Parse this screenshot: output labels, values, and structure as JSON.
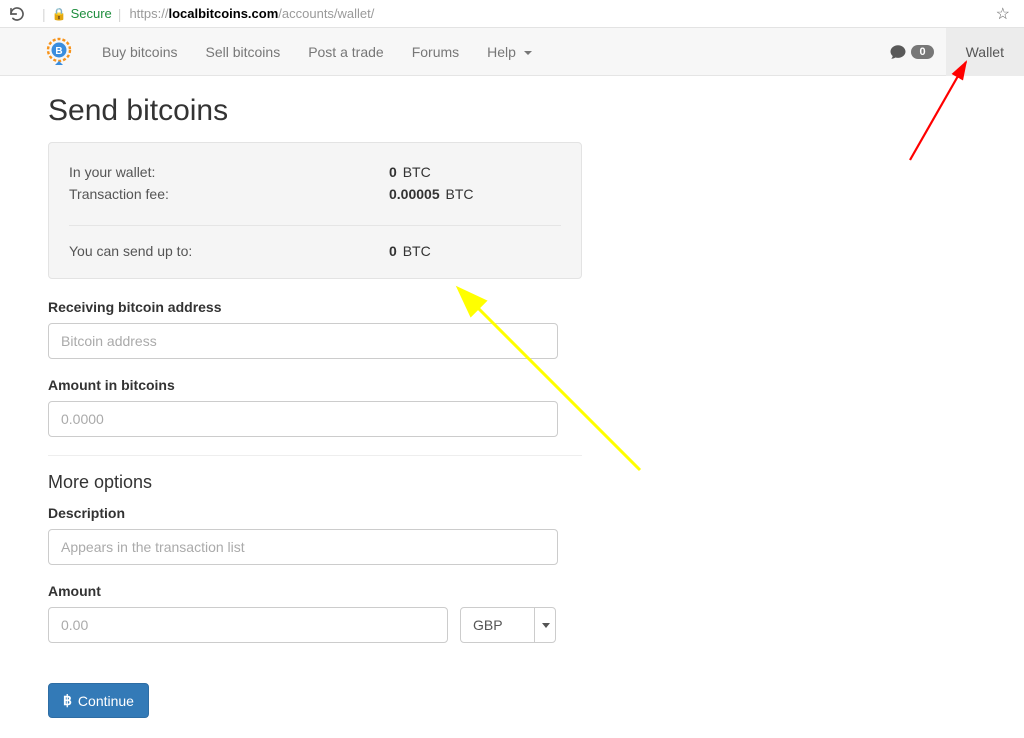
{
  "browser": {
    "secure_label": "Secure",
    "url_prefix": "https://",
    "url_host": "localbitcoins.com",
    "url_path": "/accounts/wallet/"
  },
  "nav": {
    "buy": "Buy bitcoins",
    "sell": "Sell bitcoins",
    "post": "Post a trade",
    "forums": "Forums",
    "help": "Help",
    "notif_count": "0",
    "wallet": "Wallet"
  },
  "page": {
    "title": "Send bitcoins"
  },
  "well": {
    "in_wallet_label": "In your wallet:",
    "in_wallet_value": "0",
    "tx_fee_label": "Transaction fee:",
    "tx_fee_value": "0.00005",
    "send_upto_label": "You can send up to:",
    "send_upto_value": "0",
    "unit": "BTC"
  },
  "form": {
    "recv_label": "Receiving bitcoin address",
    "recv_placeholder": "Bitcoin address",
    "amount_btc_label": "Amount in bitcoins",
    "amount_btc_placeholder": "0.0000",
    "more_options": "More options",
    "desc_label": "Description",
    "desc_placeholder": "Appears in the transaction list",
    "amount_label": "Amount",
    "amount_fiat_placeholder": "0.00",
    "currency": "GBP",
    "continue_label": "Continue"
  }
}
